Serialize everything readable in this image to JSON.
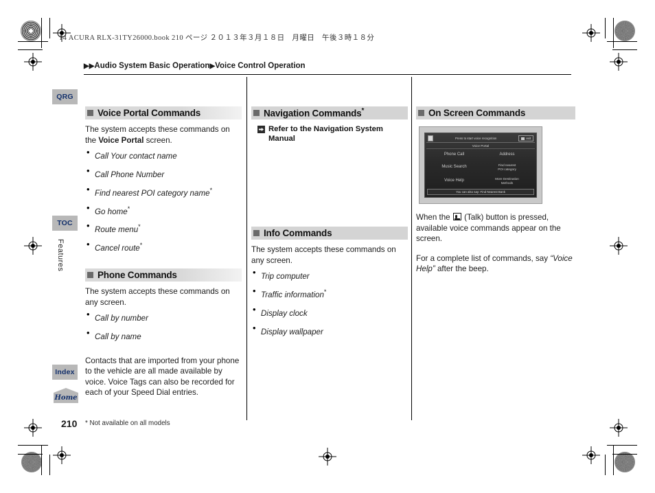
{
  "print_header": {
    "book_line": "14 ACURA RLX-31TY26000.book   210 ページ   ２０１３年３月１８日　月曜日　午後３時１８分"
  },
  "breadcrumb": {
    "marker": "▶▶",
    "part1": "Audio System Basic Operation",
    "sep": "▶",
    "part2": "Voice Control Operation"
  },
  "side_tabs": {
    "qrg": "QRG",
    "toc": "TOC",
    "index": "Index",
    "home": "Home",
    "vertical_label": "Features"
  },
  "columns": {
    "voice_portal": {
      "heading": "Voice Portal Commands",
      "intro_a": "The system accepts these commands on the ",
      "intro_bold": "Voice Portal",
      "intro_b": " screen.",
      "commands": [
        {
          "text": "Call Your contact name",
          "star": ""
        },
        {
          "text": "Call Phone Number",
          "star": ""
        },
        {
          "text": "Find nearest POI category name",
          "star": "*"
        },
        {
          "text": "Go home",
          "star": "*"
        },
        {
          "text": "Route menu",
          "star": "*"
        },
        {
          "text": "Cancel route",
          "star": "*"
        }
      ]
    },
    "phone": {
      "heading": "Phone Commands",
      "intro": "The system accepts these commands on any screen.",
      "commands": [
        {
          "text": "Call by number",
          "star": ""
        },
        {
          "text": "Call by name",
          "star": ""
        }
      ],
      "note": "Contacts that are imported from your phone to the vehicle are all made available by voice. Voice Tags can also be recorded for each of your Speed Dial entries."
    },
    "navigation": {
      "heading": "Navigation Commands",
      "heading_star": "*",
      "reference": "Refer to the Navigation System Manual"
    },
    "info": {
      "heading": "Info Commands",
      "intro": "The system accepts these commands on any screen.",
      "commands": [
        {
          "text": "Trip computer",
          "star": ""
        },
        {
          "text": "Traffic information",
          "star": "*"
        },
        {
          "text": "Display clock",
          "star": ""
        },
        {
          "text": "Display wallpaper",
          "star": ""
        }
      ]
    },
    "on_screen": {
      "heading": "On Screen Commands",
      "nav_screenshot": {
        "top_bar_text": "Press        to start voice recognition",
        "exit_label": "exit",
        "title": "Voice Portal",
        "cells": [
          {
            "label": "Phone Call",
            "small": false
          },
          {
            "label": "Address",
            "small": false
          },
          {
            "label": "Music Search",
            "small": false
          },
          {
            "label": "Find nearest\nPOI category",
            "small": true
          },
          {
            "label": "Voice Help",
            "small": false
          },
          {
            "label": "More Destination\nMethods",
            "small": true
          }
        ],
        "bottom_bar": "You can also say: Find Nearest Bank"
      },
      "para1_a": "When the ",
      "para1_b": " (Talk) button is pressed, available voice commands appear on the screen.",
      "para2_a": "For a complete list of commands, say ",
      "para2_quote": "“Voice Help”",
      "para2_b": " after the beep."
    }
  },
  "footer": {
    "page_number": "210",
    "footnote": "* Not available on all models"
  },
  "colors": {
    "heading_bar": "#d9d9d9",
    "heading_square": "#6a6a6a",
    "tab_bg": "#b8b8b8",
    "tab_text": "#13306b",
    "body_text": "#1b1b1b"
  }
}
